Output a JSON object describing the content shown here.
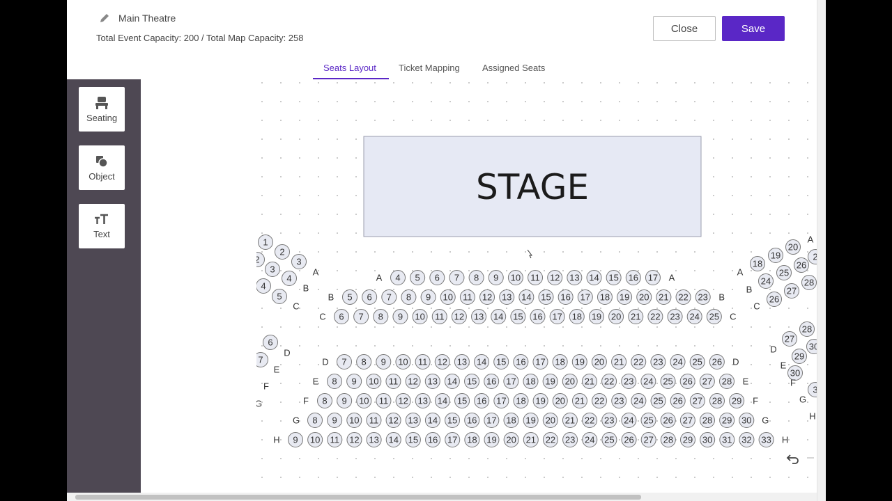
{
  "header": {
    "venue_name": "Main Theatre",
    "capacity_text": "Total Event Capacity: 200 / Total Map Capacity: 258",
    "close_label": "Close",
    "save_label": "Save"
  },
  "tabs": [
    {
      "label": "Seats Layout",
      "active": true
    },
    {
      "label": "Ticket Mapping",
      "active": false
    },
    {
      "label": "Assigned Seats",
      "active": false
    }
  ],
  "tools": [
    {
      "label": "Seating",
      "icon": "seat-icon"
    },
    {
      "label": "Object",
      "icon": "shapes-icon"
    },
    {
      "label": "Text",
      "icon": "text-size-icon"
    }
  ],
  "stage": {
    "label": "STAGE"
  },
  "seat_map": {
    "rows": [
      {
        "row": "A",
        "first": 4,
        "last": 17
      },
      {
        "row": "B",
        "first": 5,
        "last": 23
      },
      {
        "row": "C",
        "first": 6,
        "last": 25
      },
      {
        "row": "D",
        "first": 7,
        "last": 26
      },
      {
        "row": "E",
        "first": 8,
        "last": 28
      },
      {
        "row": "F",
        "first": 8,
        "last": 29
      },
      {
        "row": "G",
        "first": 8,
        "last": 30
      },
      {
        "row": "H",
        "first": 9,
        "last": 33
      }
    ],
    "left_wing_seats": [
      "1",
      "2",
      "2",
      "3",
      "3",
      "4",
      "4",
      "5",
      "6",
      "7"
    ],
    "left_wing_labels": [
      "A",
      "B",
      "C",
      "D",
      "E",
      "F",
      "G"
    ],
    "right_wing_seats": [
      "20",
      "19",
      "2",
      "18",
      "26",
      "25",
      "28",
      "24",
      "27",
      "26",
      "28",
      "27",
      "30",
      "29",
      "30",
      "3"
    ],
    "right_wing_labels": [
      "A",
      "A",
      "B",
      "C",
      "D",
      "E",
      "F",
      "G",
      "H"
    ]
  },
  "colors": {
    "accent": "#5a27c6",
    "stage_fill": "#e6e9f4",
    "seat_fill": "#e8eaf2",
    "sidebar": "#4e4853"
  }
}
